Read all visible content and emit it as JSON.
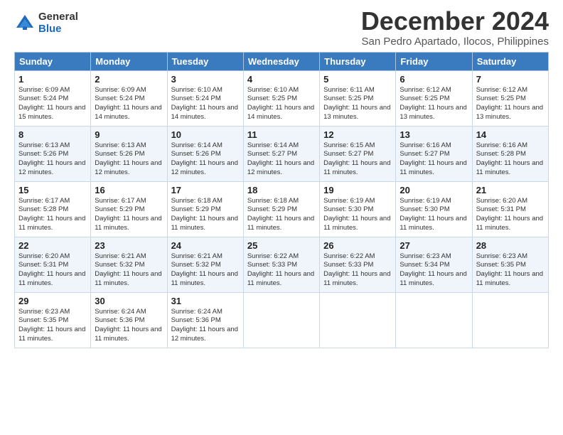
{
  "logo": {
    "general": "General",
    "blue": "Blue"
  },
  "title": {
    "month": "December 2024",
    "location": "San Pedro Apartado, Ilocos, Philippines"
  },
  "weekdays": [
    "Sunday",
    "Monday",
    "Tuesday",
    "Wednesday",
    "Thursday",
    "Friday",
    "Saturday"
  ],
  "weeks": [
    [
      {
        "day": "1",
        "sunrise": "6:09 AM",
        "sunset": "5:24 PM",
        "daylight": "11 hours and 15 minutes."
      },
      {
        "day": "2",
        "sunrise": "6:09 AM",
        "sunset": "5:24 PM",
        "daylight": "11 hours and 14 minutes."
      },
      {
        "day": "3",
        "sunrise": "6:10 AM",
        "sunset": "5:24 PM",
        "daylight": "11 hours and 14 minutes."
      },
      {
        "day": "4",
        "sunrise": "6:10 AM",
        "sunset": "5:25 PM",
        "daylight": "11 hours and 14 minutes."
      },
      {
        "day": "5",
        "sunrise": "6:11 AM",
        "sunset": "5:25 PM",
        "daylight": "11 hours and 13 minutes."
      },
      {
        "day": "6",
        "sunrise": "6:12 AM",
        "sunset": "5:25 PM",
        "daylight": "11 hours and 13 minutes."
      },
      {
        "day": "7",
        "sunrise": "6:12 AM",
        "sunset": "5:25 PM",
        "daylight": "11 hours and 13 minutes."
      }
    ],
    [
      {
        "day": "8",
        "sunrise": "6:13 AM",
        "sunset": "5:26 PM",
        "daylight": "11 hours and 12 minutes."
      },
      {
        "day": "9",
        "sunrise": "6:13 AM",
        "sunset": "5:26 PM",
        "daylight": "11 hours and 12 minutes."
      },
      {
        "day": "10",
        "sunrise": "6:14 AM",
        "sunset": "5:26 PM",
        "daylight": "11 hours and 12 minutes."
      },
      {
        "day": "11",
        "sunrise": "6:14 AM",
        "sunset": "5:27 PM",
        "daylight": "11 hours and 12 minutes."
      },
      {
        "day": "12",
        "sunrise": "6:15 AM",
        "sunset": "5:27 PM",
        "daylight": "11 hours and 11 minutes."
      },
      {
        "day": "13",
        "sunrise": "6:16 AM",
        "sunset": "5:27 PM",
        "daylight": "11 hours and 11 minutes."
      },
      {
        "day": "14",
        "sunrise": "6:16 AM",
        "sunset": "5:28 PM",
        "daylight": "11 hours and 11 minutes."
      }
    ],
    [
      {
        "day": "15",
        "sunrise": "6:17 AM",
        "sunset": "5:28 PM",
        "daylight": "11 hours and 11 minutes."
      },
      {
        "day": "16",
        "sunrise": "6:17 AM",
        "sunset": "5:29 PM",
        "daylight": "11 hours and 11 minutes."
      },
      {
        "day": "17",
        "sunrise": "6:18 AM",
        "sunset": "5:29 PM",
        "daylight": "11 hours and 11 minutes."
      },
      {
        "day": "18",
        "sunrise": "6:18 AM",
        "sunset": "5:29 PM",
        "daylight": "11 hours and 11 minutes."
      },
      {
        "day": "19",
        "sunrise": "6:19 AM",
        "sunset": "5:30 PM",
        "daylight": "11 hours and 11 minutes."
      },
      {
        "day": "20",
        "sunrise": "6:19 AM",
        "sunset": "5:30 PM",
        "daylight": "11 hours and 11 minutes."
      },
      {
        "day": "21",
        "sunrise": "6:20 AM",
        "sunset": "5:31 PM",
        "daylight": "11 hours and 11 minutes."
      }
    ],
    [
      {
        "day": "22",
        "sunrise": "6:20 AM",
        "sunset": "5:31 PM",
        "daylight": "11 hours and 11 minutes."
      },
      {
        "day": "23",
        "sunrise": "6:21 AM",
        "sunset": "5:32 PM",
        "daylight": "11 hours and 11 minutes."
      },
      {
        "day": "24",
        "sunrise": "6:21 AM",
        "sunset": "5:32 PM",
        "daylight": "11 hours and 11 minutes."
      },
      {
        "day": "25",
        "sunrise": "6:22 AM",
        "sunset": "5:33 PM",
        "daylight": "11 hours and 11 minutes."
      },
      {
        "day": "26",
        "sunrise": "6:22 AM",
        "sunset": "5:33 PM",
        "daylight": "11 hours and 11 minutes."
      },
      {
        "day": "27",
        "sunrise": "6:23 AM",
        "sunset": "5:34 PM",
        "daylight": "11 hours and 11 minutes."
      },
      {
        "day": "28",
        "sunrise": "6:23 AM",
        "sunset": "5:35 PM",
        "daylight": "11 hours and 11 minutes."
      }
    ],
    [
      {
        "day": "29",
        "sunrise": "6:23 AM",
        "sunset": "5:35 PM",
        "daylight": "11 hours and 11 minutes."
      },
      {
        "day": "30",
        "sunrise": "6:24 AM",
        "sunset": "5:36 PM",
        "daylight": "11 hours and 11 minutes."
      },
      {
        "day": "31",
        "sunrise": "6:24 AM",
        "sunset": "5:36 PM",
        "daylight": "11 hours and 12 minutes."
      },
      null,
      null,
      null,
      null
    ]
  ]
}
